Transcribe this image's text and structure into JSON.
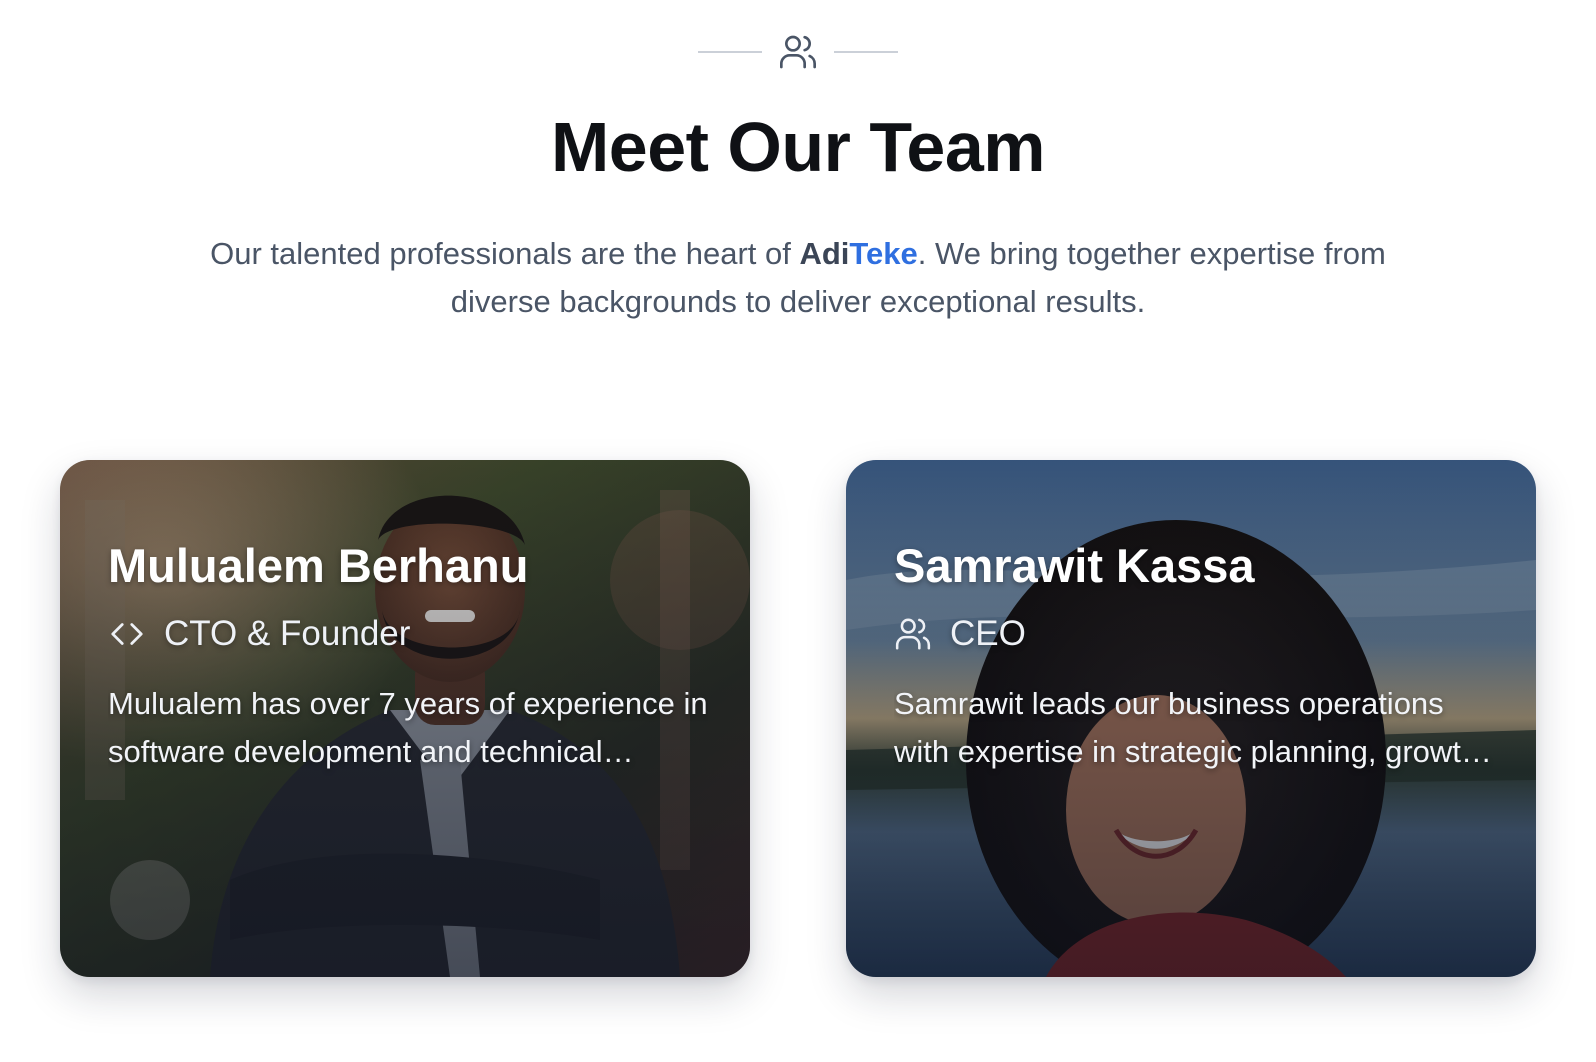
{
  "header": {
    "icon": "users-icon",
    "title": "Meet Our Team",
    "intro_before": "Our talented professionals are the heart of ",
    "brand_part_1": "Adi",
    "brand_part_2": "Teke",
    "intro_after": ". We bring together expertise from diverse backgrounds to deliver exceptional results."
  },
  "team": [
    {
      "name": "Mulualem Berhanu",
      "role": "CTO & Founder",
      "role_icon": "code-icon",
      "bio": "Mulualem has over 7 years of experience in software development and technical leadership"
    },
    {
      "name": "Samrawit Kassa",
      "role": "CEO",
      "role_icon": "users-icon",
      "bio": "Samrawit leads our business operations with expertise in strategic planning, growth and partnerships"
    }
  ],
  "colors": {
    "brand_accent": "#2f6fe0",
    "title": "#0f1115",
    "body_text": "#4a5566"
  }
}
